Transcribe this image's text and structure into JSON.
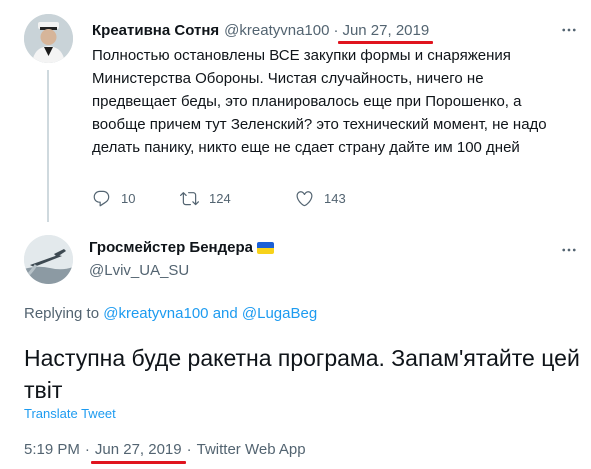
{
  "tweet1": {
    "name": "Креативна Сотня",
    "handle": "@kreatyvna100",
    "separator": "·",
    "date": "Jun 27, 2019",
    "text": "Полностью остановлены ВСЕ закупки формы и снаряжения Министерства Обороны. Чистая случайность, ничего не предвещает беды, это планировалось еще при Порошенко, а вообще причем тут Зеленский? это технический момент, не надо делать панику, никто еще не сдает страну дайте им 100 дней",
    "replies": "10",
    "retweets": "124",
    "likes": "143"
  },
  "tweet2": {
    "name": "Гросмейстер Бендера",
    "handle": "@Lviv_UA_SU",
    "replying_prefix": "Replying to",
    "replying_user1": "@kreatyvna100",
    "replying_and": "and",
    "replying_user2": "@LugaBeg",
    "text": "Наступна буде ракетна програма. Запам'ятайте цей твіт",
    "translate": "Translate Tweet",
    "time": "5:19 PM",
    "dot1": "·",
    "date": "Jun 27, 2019",
    "dot2": "·",
    "source": "Twitter Web App"
  },
  "colors": {
    "accent": "#1d9bf0",
    "secondary_text": "#536471",
    "annotation_underline": "#e0141e",
    "flag_blue": "#1a5fd6",
    "flag_yellow": "#f7d21a"
  },
  "icons": [
    "reply-icon",
    "retweet-icon",
    "like-icon",
    "more-icon"
  ]
}
